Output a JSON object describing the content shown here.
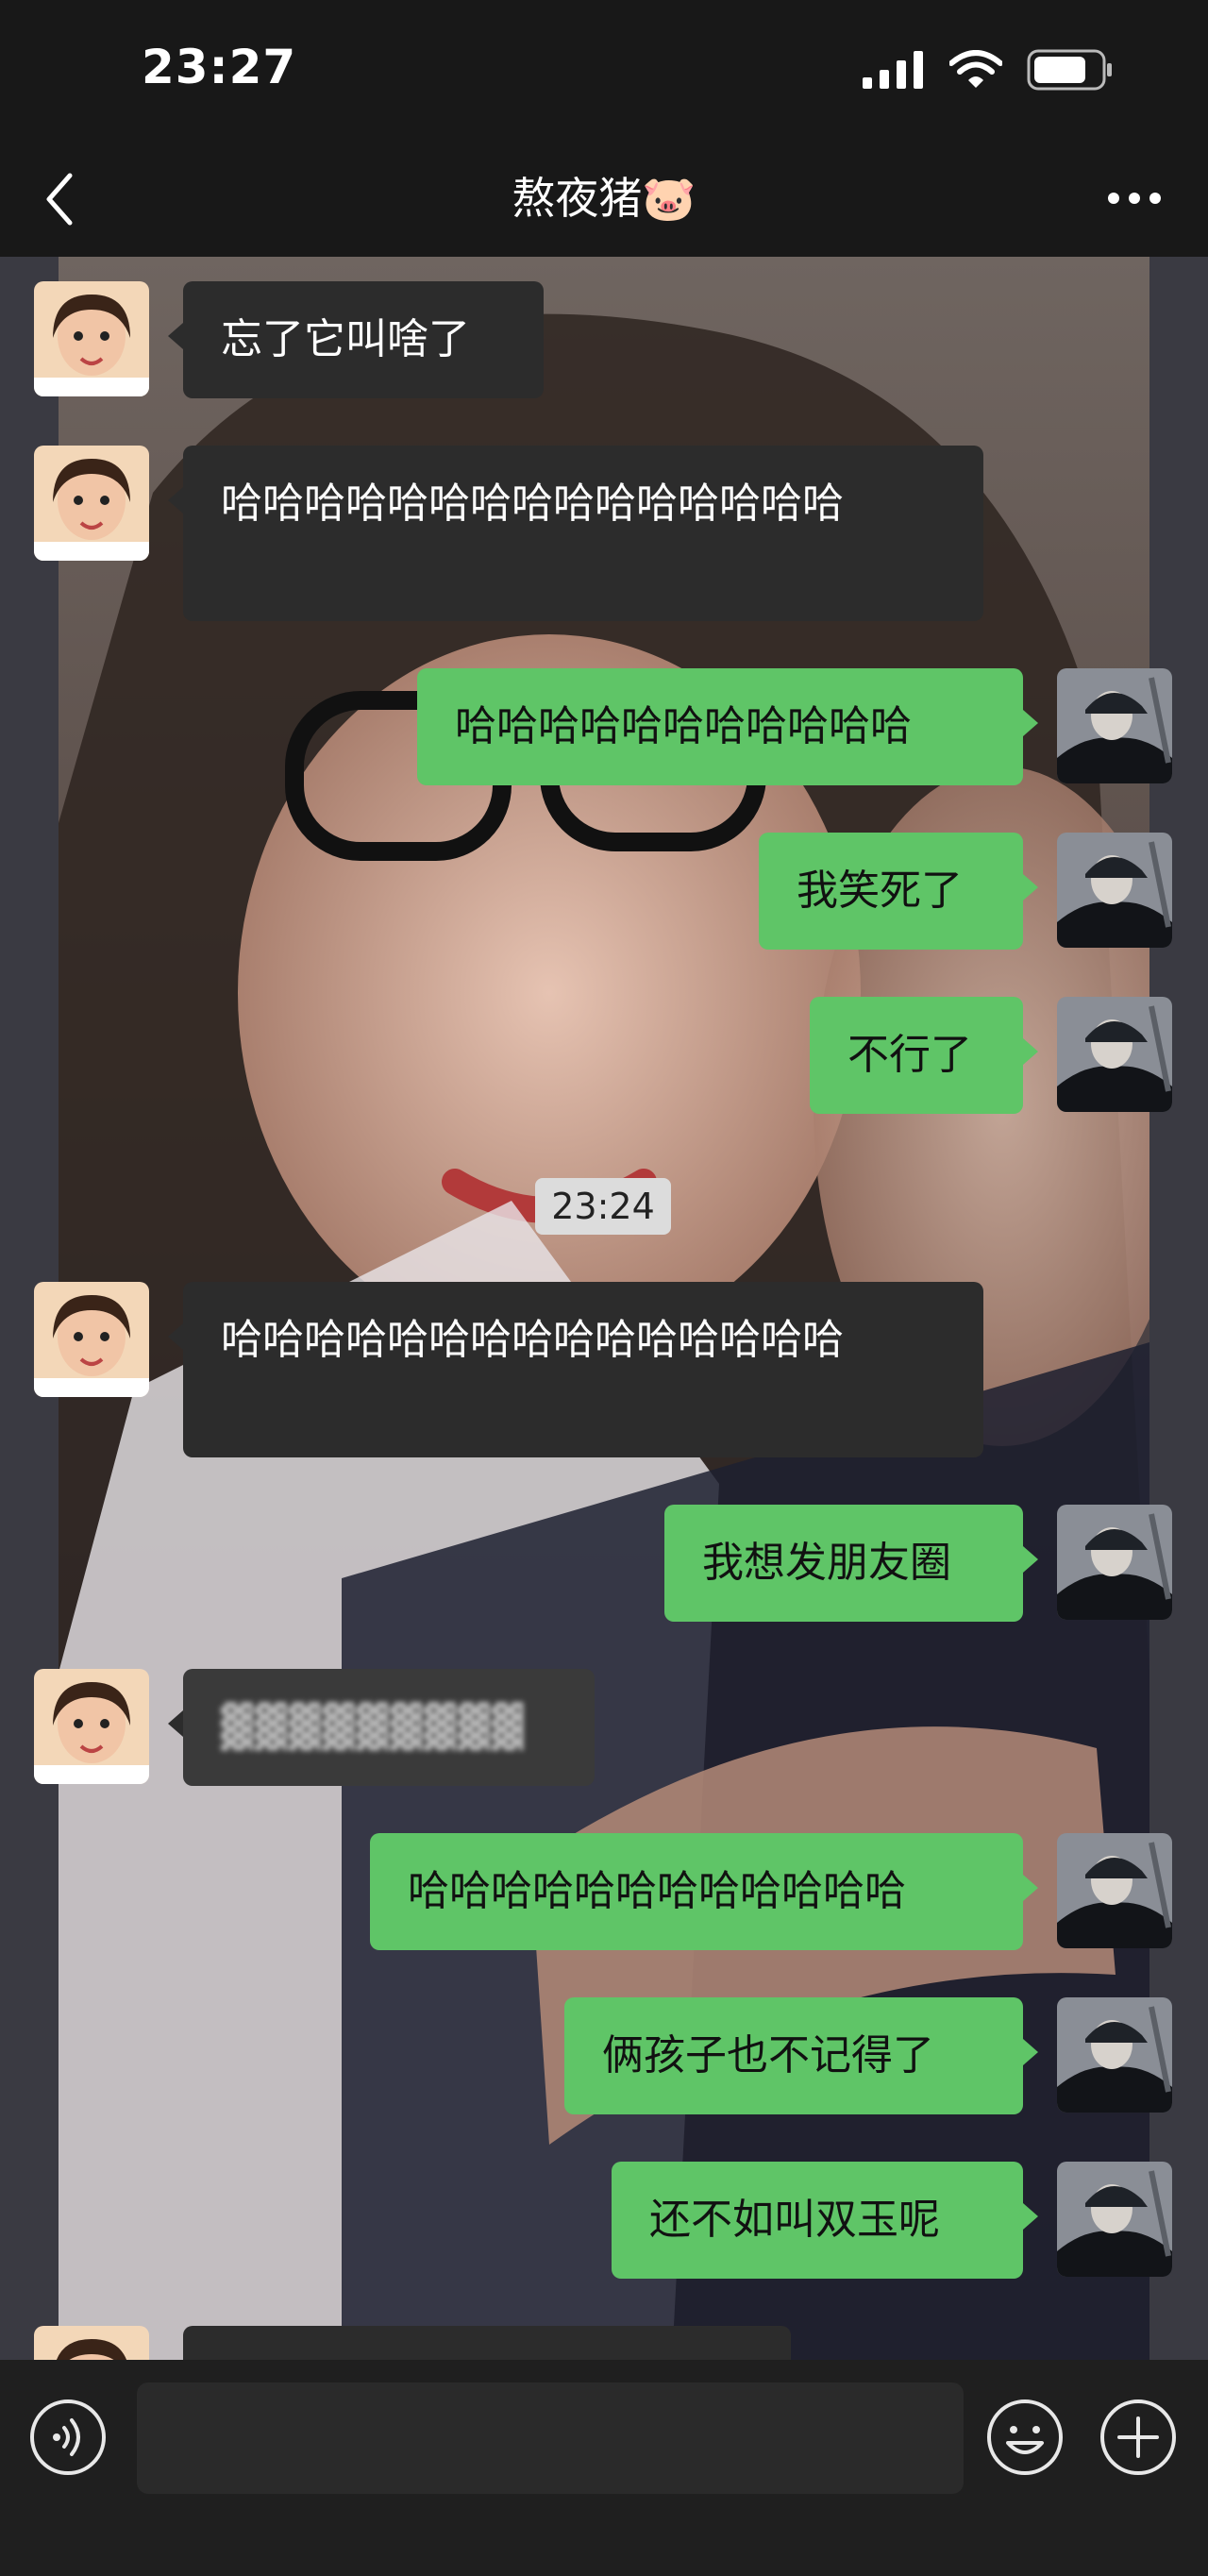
{
  "status_bar": {
    "time": "23:27"
  },
  "header": {
    "title": "熬夜猪🐷"
  },
  "messages": [
    {
      "side": "left",
      "text": "忘了它叫啥了"
    },
    {
      "side": "left",
      "text": "哈哈哈哈哈哈哈哈哈哈哈哈哈哈哈"
    },
    {
      "side": "right",
      "text": "哈哈哈哈哈哈哈哈哈哈哈"
    },
    {
      "side": "right",
      "text": "我笑死了"
    },
    {
      "side": "right",
      "text": "不行了"
    },
    {
      "side": "left",
      "text": "哈哈哈哈哈哈哈哈哈哈哈哈哈哈哈"
    },
    {
      "side": "right",
      "text": "我想发朋友圈"
    },
    {
      "side": "left",
      "text": "▓▓▓▓▓▓▓▓▓"
    },
    {
      "side": "right",
      "text": "哈哈哈哈哈哈哈哈哈哈哈哈"
    },
    {
      "side": "right",
      "text": "俩孩子也不记得了"
    },
    {
      "side": "right",
      "text": "还不如叫双玉呢"
    }
  ],
  "timestamp": "23:24",
  "input": {
    "placeholder": ""
  }
}
